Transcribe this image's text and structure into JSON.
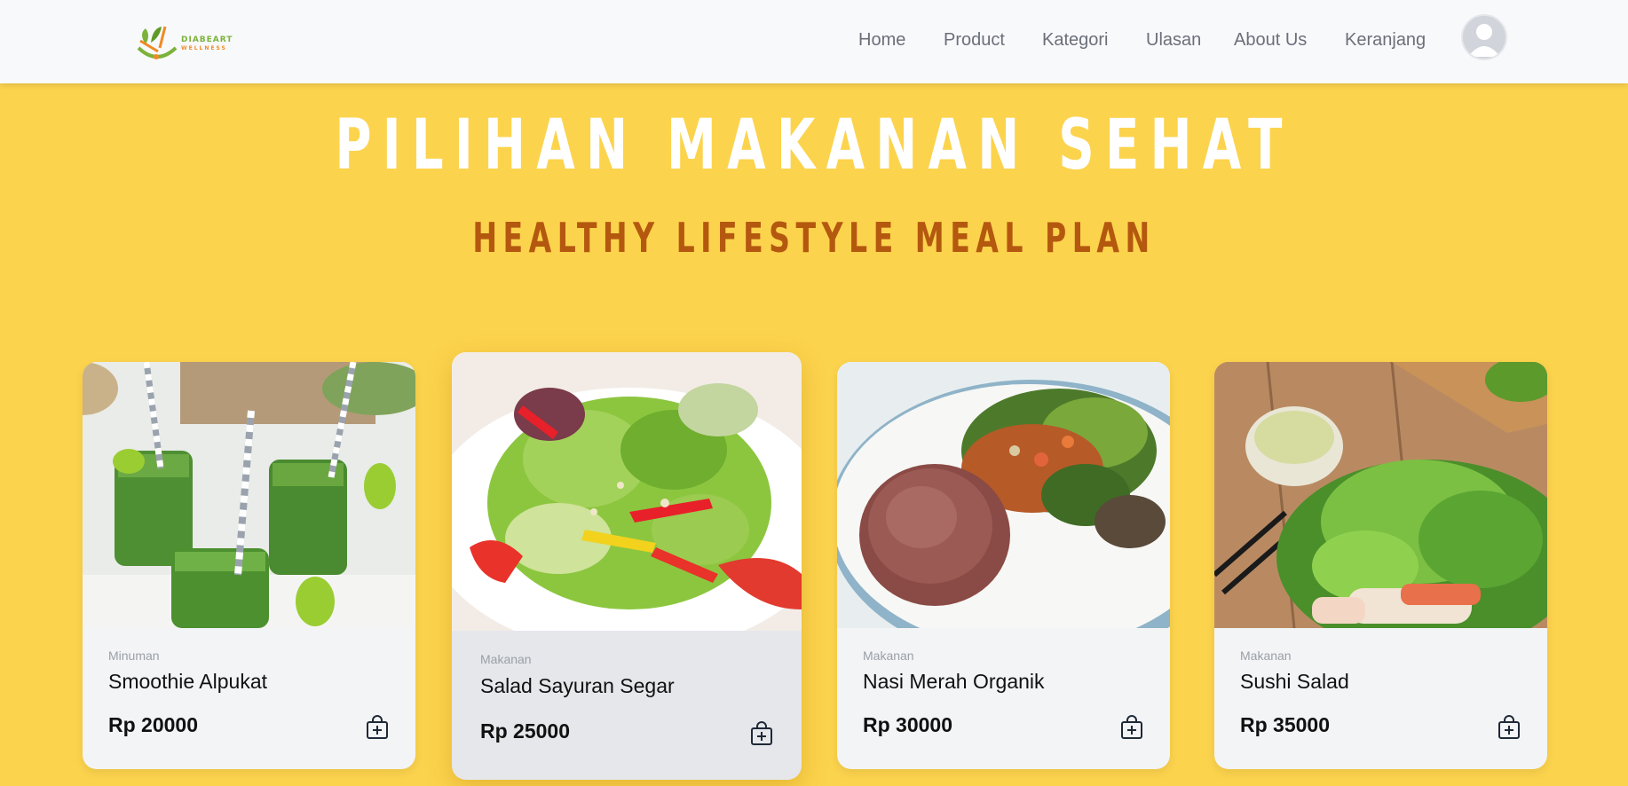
{
  "brand": {
    "line1": "DIABEART",
    "line2": "WELLNESS"
  },
  "nav": {
    "items": [
      {
        "label": "Home"
      },
      {
        "label": "Product"
      },
      {
        "label": "Kategori"
      },
      {
        "label": "Ulasan"
      },
      {
        "label": "About Us"
      },
      {
        "label": "Keranjang"
      }
    ]
  },
  "hero": {
    "title": "PILIHAN MAKANAN SEHAT",
    "subtitle": "HEALTHY LIFESTYLE MEAL PLAN"
  },
  "products": [
    {
      "category": "Minuman",
      "name": "Smoothie Alpukat",
      "price": "Rp 20000"
    },
    {
      "category": "Makanan",
      "name": "Salad Sayuran Segar",
      "price": "Rp 25000"
    },
    {
      "category": "Makanan",
      "name": "Nasi Merah Organik",
      "price": "Rp 30000"
    },
    {
      "category": "Makanan",
      "name": "Sushi Salad",
      "price": "Rp 35000"
    }
  ],
  "icons": {
    "cart": "shopping-bag-plus-icon",
    "avatar": "user-avatar-icon"
  },
  "colors": {
    "page_bg": "#fcd34d",
    "hero_subtitle": "#b4580f",
    "header_bg": "#f8f9fb"
  }
}
